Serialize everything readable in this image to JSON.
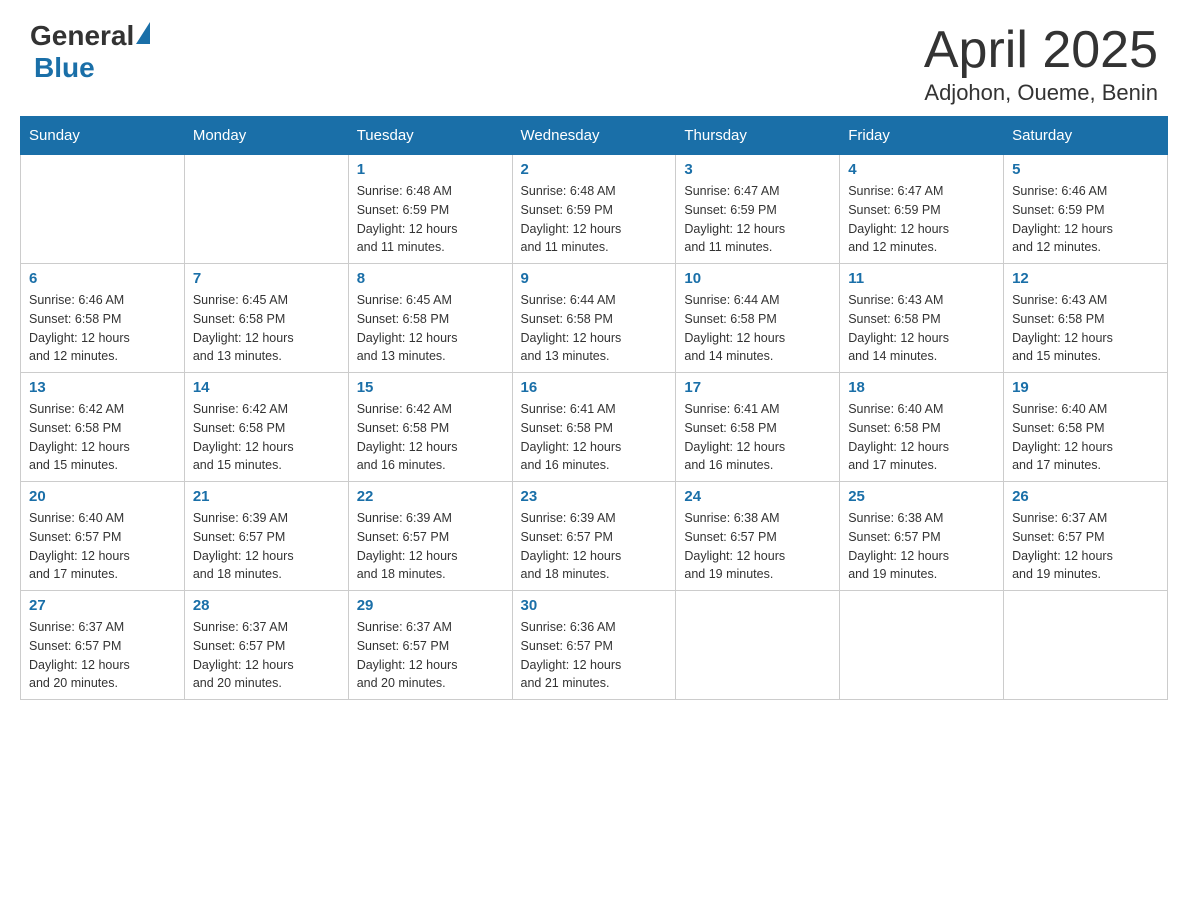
{
  "logo": {
    "general": "General",
    "triangle": "",
    "blue": "Blue"
  },
  "title": {
    "month_year": "April 2025",
    "location": "Adjohon, Oueme, Benin"
  },
  "weekdays": [
    "Sunday",
    "Monday",
    "Tuesday",
    "Wednesday",
    "Thursday",
    "Friday",
    "Saturday"
  ],
  "weeks": [
    [
      {
        "day": "",
        "info": ""
      },
      {
        "day": "",
        "info": ""
      },
      {
        "day": "1",
        "info": "Sunrise: 6:48 AM\nSunset: 6:59 PM\nDaylight: 12 hours\nand 11 minutes."
      },
      {
        "day": "2",
        "info": "Sunrise: 6:48 AM\nSunset: 6:59 PM\nDaylight: 12 hours\nand 11 minutes."
      },
      {
        "day": "3",
        "info": "Sunrise: 6:47 AM\nSunset: 6:59 PM\nDaylight: 12 hours\nand 11 minutes."
      },
      {
        "day": "4",
        "info": "Sunrise: 6:47 AM\nSunset: 6:59 PM\nDaylight: 12 hours\nand 12 minutes."
      },
      {
        "day": "5",
        "info": "Sunrise: 6:46 AM\nSunset: 6:59 PM\nDaylight: 12 hours\nand 12 minutes."
      }
    ],
    [
      {
        "day": "6",
        "info": "Sunrise: 6:46 AM\nSunset: 6:58 PM\nDaylight: 12 hours\nand 12 minutes."
      },
      {
        "day": "7",
        "info": "Sunrise: 6:45 AM\nSunset: 6:58 PM\nDaylight: 12 hours\nand 13 minutes."
      },
      {
        "day": "8",
        "info": "Sunrise: 6:45 AM\nSunset: 6:58 PM\nDaylight: 12 hours\nand 13 minutes."
      },
      {
        "day": "9",
        "info": "Sunrise: 6:44 AM\nSunset: 6:58 PM\nDaylight: 12 hours\nand 13 minutes."
      },
      {
        "day": "10",
        "info": "Sunrise: 6:44 AM\nSunset: 6:58 PM\nDaylight: 12 hours\nand 14 minutes."
      },
      {
        "day": "11",
        "info": "Sunrise: 6:43 AM\nSunset: 6:58 PM\nDaylight: 12 hours\nand 14 minutes."
      },
      {
        "day": "12",
        "info": "Sunrise: 6:43 AM\nSunset: 6:58 PM\nDaylight: 12 hours\nand 15 minutes."
      }
    ],
    [
      {
        "day": "13",
        "info": "Sunrise: 6:42 AM\nSunset: 6:58 PM\nDaylight: 12 hours\nand 15 minutes."
      },
      {
        "day": "14",
        "info": "Sunrise: 6:42 AM\nSunset: 6:58 PM\nDaylight: 12 hours\nand 15 minutes."
      },
      {
        "day": "15",
        "info": "Sunrise: 6:42 AM\nSunset: 6:58 PM\nDaylight: 12 hours\nand 16 minutes."
      },
      {
        "day": "16",
        "info": "Sunrise: 6:41 AM\nSunset: 6:58 PM\nDaylight: 12 hours\nand 16 minutes."
      },
      {
        "day": "17",
        "info": "Sunrise: 6:41 AM\nSunset: 6:58 PM\nDaylight: 12 hours\nand 16 minutes."
      },
      {
        "day": "18",
        "info": "Sunrise: 6:40 AM\nSunset: 6:58 PM\nDaylight: 12 hours\nand 17 minutes."
      },
      {
        "day": "19",
        "info": "Sunrise: 6:40 AM\nSunset: 6:58 PM\nDaylight: 12 hours\nand 17 minutes."
      }
    ],
    [
      {
        "day": "20",
        "info": "Sunrise: 6:40 AM\nSunset: 6:57 PM\nDaylight: 12 hours\nand 17 minutes."
      },
      {
        "day": "21",
        "info": "Sunrise: 6:39 AM\nSunset: 6:57 PM\nDaylight: 12 hours\nand 18 minutes."
      },
      {
        "day": "22",
        "info": "Sunrise: 6:39 AM\nSunset: 6:57 PM\nDaylight: 12 hours\nand 18 minutes."
      },
      {
        "day": "23",
        "info": "Sunrise: 6:39 AM\nSunset: 6:57 PM\nDaylight: 12 hours\nand 18 minutes."
      },
      {
        "day": "24",
        "info": "Sunrise: 6:38 AM\nSunset: 6:57 PM\nDaylight: 12 hours\nand 19 minutes."
      },
      {
        "day": "25",
        "info": "Sunrise: 6:38 AM\nSunset: 6:57 PM\nDaylight: 12 hours\nand 19 minutes."
      },
      {
        "day": "26",
        "info": "Sunrise: 6:37 AM\nSunset: 6:57 PM\nDaylight: 12 hours\nand 19 minutes."
      }
    ],
    [
      {
        "day": "27",
        "info": "Sunrise: 6:37 AM\nSunset: 6:57 PM\nDaylight: 12 hours\nand 20 minutes."
      },
      {
        "day": "28",
        "info": "Sunrise: 6:37 AM\nSunset: 6:57 PM\nDaylight: 12 hours\nand 20 minutes."
      },
      {
        "day": "29",
        "info": "Sunrise: 6:37 AM\nSunset: 6:57 PM\nDaylight: 12 hours\nand 20 minutes."
      },
      {
        "day": "30",
        "info": "Sunrise: 6:36 AM\nSunset: 6:57 PM\nDaylight: 12 hours\nand 21 minutes."
      },
      {
        "day": "",
        "info": ""
      },
      {
        "day": "",
        "info": ""
      },
      {
        "day": "",
        "info": ""
      }
    ]
  ]
}
